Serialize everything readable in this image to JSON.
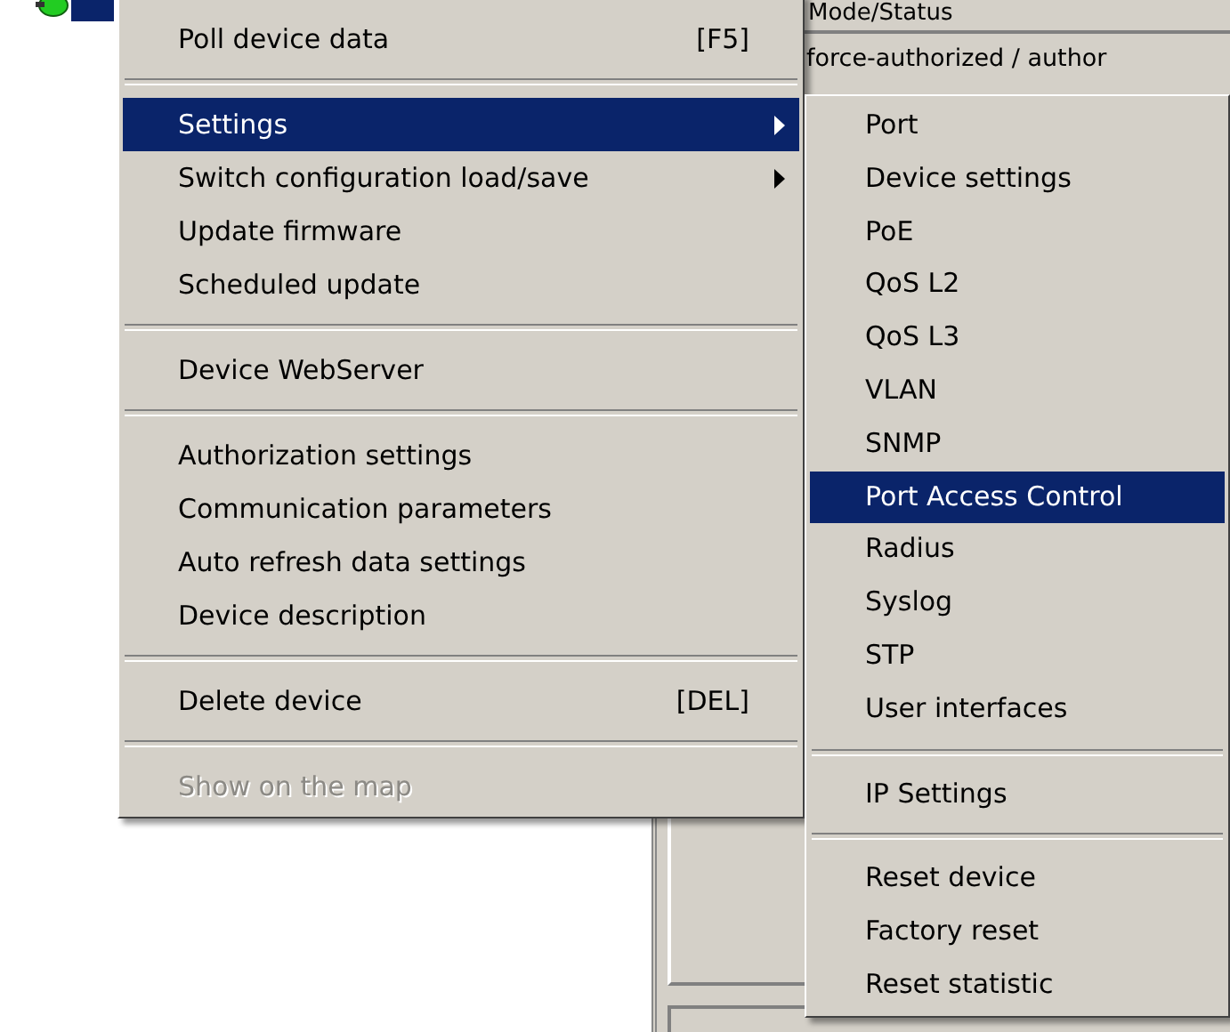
{
  "background_table": {
    "header": "Mode/Status",
    "cell": "force-authorized / author"
  },
  "context_menu": {
    "items": [
      {
        "kind": "item",
        "label": "Poll device data",
        "shortcut": "[F5]",
        "submenu": false,
        "selected": false,
        "disabled": false
      },
      {
        "kind": "separator"
      },
      {
        "kind": "item",
        "label": "Settings",
        "submenu": true,
        "selected": true,
        "disabled": false
      },
      {
        "kind": "item",
        "label": "Switch configuration load/save",
        "submenu": true,
        "selected": false,
        "disabled": false
      },
      {
        "kind": "item",
        "label": "Update firmware",
        "submenu": false,
        "selected": false,
        "disabled": false
      },
      {
        "kind": "item",
        "label": "Scheduled update",
        "submenu": false,
        "selected": false,
        "disabled": false
      },
      {
        "kind": "separator"
      },
      {
        "kind": "item",
        "label": "Device WebServer",
        "submenu": false,
        "selected": false,
        "disabled": false
      },
      {
        "kind": "separator"
      },
      {
        "kind": "item",
        "label": "Authorization settings",
        "submenu": false,
        "selected": false,
        "disabled": false
      },
      {
        "kind": "item",
        "label": "Communication parameters",
        "submenu": false,
        "selected": false,
        "disabled": false
      },
      {
        "kind": "item",
        "label": "Auto refresh data settings",
        "submenu": false,
        "selected": false,
        "disabled": false
      },
      {
        "kind": "item",
        "label": "Device description",
        "submenu": false,
        "selected": false,
        "disabled": false
      },
      {
        "kind": "separator"
      },
      {
        "kind": "item",
        "label": "Delete device",
        "shortcut": "[DEL]",
        "submenu": false,
        "selected": false,
        "disabled": false
      },
      {
        "kind": "separator"
      },
      {
        "kind": "item",
        "label": "Show on the map",
        "submenu": false,
        "selected": false,
        "disabled": true
      }
    ]
  },
  "settings_submenu": {
    "items": [
      {
        "kind": "item",
        "label": "Port",
        "selected": false
      },
      {
        "kind": "item",
        "label": "Device settings",
        "selected": false
      },
      {
        "kind": "item",
        "label": "PoE",
        "selected": false
      },
      {
        "kind": "item",
        "label": "QoS L2",
        "selected": false
      },
      {
        "kind": "item",
        "label": "QoS L3",
        "selected": false
      },
      {
        "kind": "item",
        "label": "VLAN",
        "selected": false
      },
      {
        "kind": "item",
        "label": "SNMP",
        "selected": false
      },
      {
        "kind": "item",
        "label": "Port Access Control",
        "selected": true
      },
      {
        "kind": "item",
        "label": "Radius",
        "selected": false
      },
      {
        "kind": "item",
        "label": "Syslog",
        "selected": false
      },
      {
        "kind": "item",
        "label": "STP",
        "selected": false
      },
      {
        "kind": "item",
        "label": "User interfaces",
        "selected": false
      },
      {
        "kind": "separator"
      },
      {
        "kind": "item",
        "label": "IP Settings",
        "selected": false
      },
      {
        "kind": "separator"
      },
      {
        "kind": "item",
        "label": "Reset device",
        "selected": false
      },
      {
        "kind": "item",
        "label": "Factory reset",
        "selected": false
      },
      {
        "kind": "item",
        "label": "Reset statistic",
        "selected": false
      }
    ]
  }
}
